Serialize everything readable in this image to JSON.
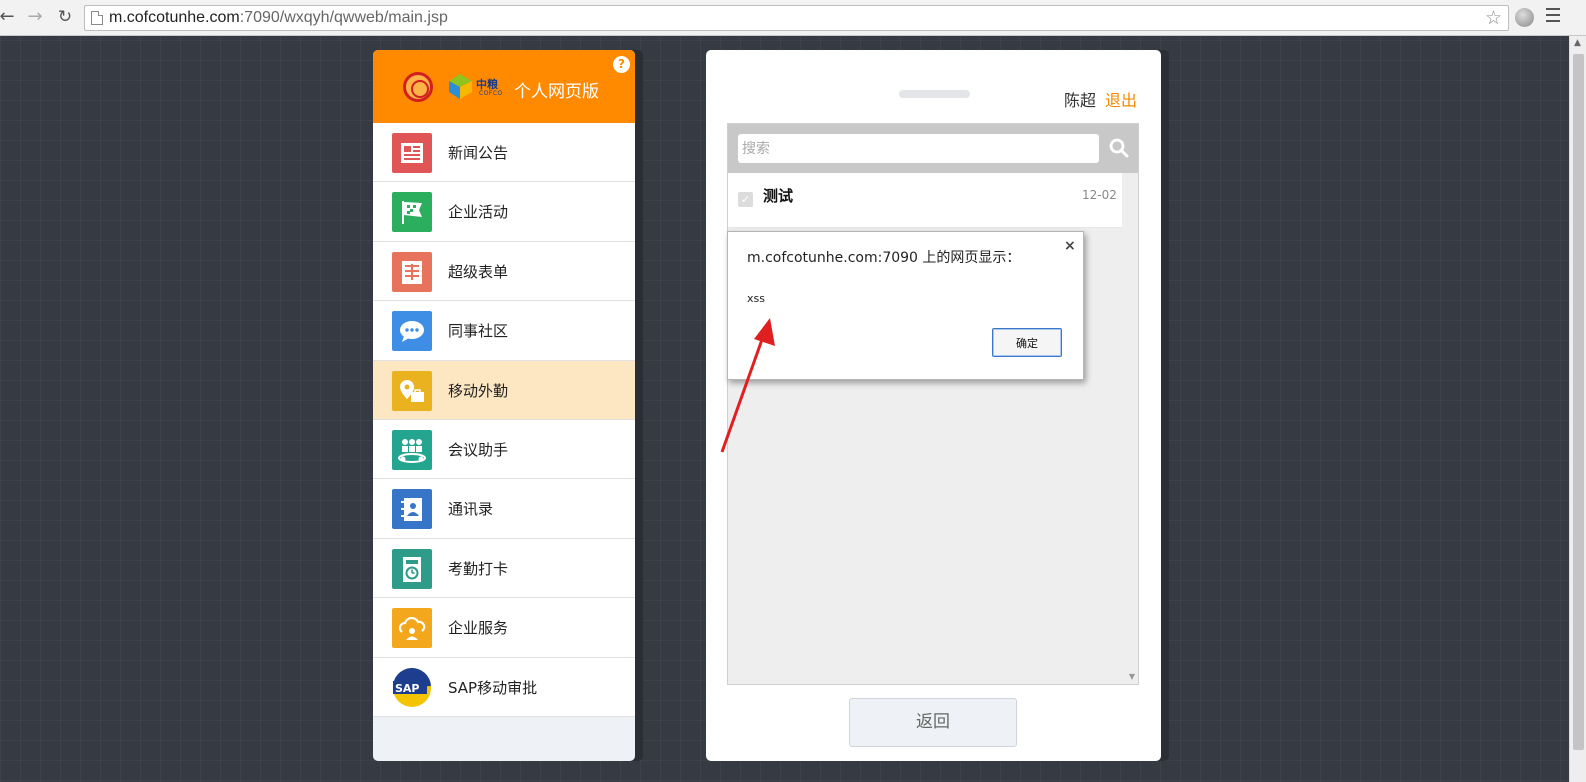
{
  "browser": {
    "url_host": "m.cofcotunhe.com",
    "url_rest": ":7090/wxqyh/qwweb/main.jsp"
  },
  "left_panel": {
    "logo_cn": "中粮",
    "logo_en": "COFCO",
    "title": "个人网页版",
    "menu_items": [
      {
        "label": "新闻公告",
        "icon": "newspaper-icon",
        "color": "#e05656",
        "active": false
      },
      {
        "label": "企业活动",
        "icon": "flag-icon",
        "color": "#2cae5f",
        "active": false
      },
      {
        "label": "超级表单",
        "icon": "form-icon",
        "color": "#e7735c",
        "active": false
      },
      {
        "label": "同事社区",
        "icon": "chat-bubble-icon",
        "color": "#3d8ee4",
        "active": false
      },
      {
        "label": "移动外勤",
        "icon": "location-briefcase-icon",
        "color": "#e9b21e",
        "active": true
      },
      {
        "label": "会议助手",
        "icon": "meeting-people-icon",
        "color": "#23a58f",
        "active": false
      },
      {
        "label": "通讯录",
        "icon": "contacts-book-icon",
        "color": "#3775c9",
        "active": false
      },
      {
        "label": "考勤打卡",
        "icon": "time-clock-icon",
        "color": "#2f9c8a",
        "active": false
      },
      {
        "label": "企业服务",
        "icon": "cloud-service-icon",
        "color": "#f3a71c",
        "active": false
      },
      {
        "label": "SAP移动审批",
        "icon": "sap-logo-icon",
        "color": "#1d3d8f",
        "active": false
      }
    ]
  },
  "right_panel": {
    "user_name": "陈超",
    "logout": "退出",
    "search_placeholder": "搜索",
    "news": [
      {
        "title": "测试",
        "date": "12-02"
      }
    ],
    "back_button": "返回"
  },
  "alert": {
    "title": "m.cofcotunhe.com:7090 上的网页显示：",
    "message": "xss",
    "ok_button": "确定",
    "close": "×"
  },
  "colors": {
    "header_orange": "#ff8a00",
    "logout_orange": "#f08a00",
    "active_row": "#fde6c2",
    "annotation_arrow": "#e02020"
  }
}
